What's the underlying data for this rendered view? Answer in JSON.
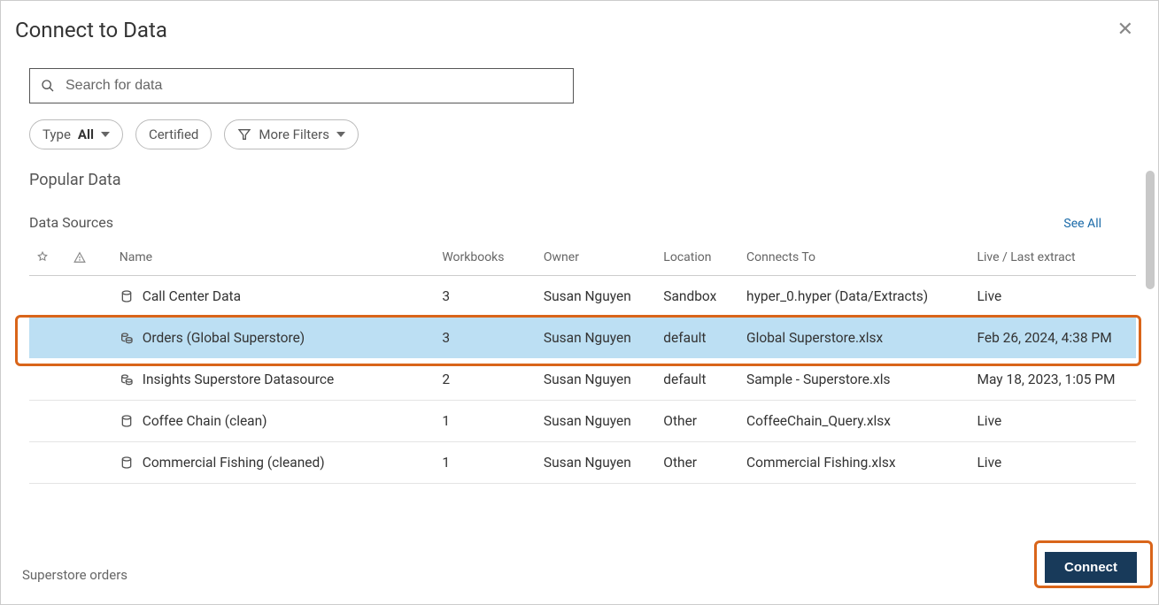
{
  "dialog": {
    "title": "Connect to Data"
  },
  "search": {
    "placeholder": "Search for data"
  },
  "filters": {
    "type_prefix": "Type",
    "type_value": "All",
    "certified": "Certified",
    "more": "More Filters"
  },
  "sections": {
    "popular": "Popular Data",
    "datasources": "Data Sources",
    "see_all": "See All"
  },
  "columns": {
    "name": "Name",
    "workbooks": "Workbooks",
    "owner": "Owner",
    "location": "Location",
    "connects_to": "Connects To",
    "live": "Live / Last extract"
  },
  "rows": [
    {
      "icon": "datasource",
      "name": "Call Center Data",
      "workbooks": "3",
      "owner": "Susan Nguyen",
      "location": "Sandbox",
      "connects_to": "hyper_0.hyper (Data/Extracts)",
      "live": "Live",
      "selected": false
    },
    {
      "icon": "published",
      "name": "Orders (Global Superstore)",
      "workbooks": "3",
      "owner": "Susan Nguyen",
      "location": "default",
      "connects_to": "Global Superstore.xlsx",
      "live": "Feb 26, 2024, 4:38 PM",
      "selected": true
    },
    {
      "icon": "published",
      "name": "Insights Superstore Datasource",
      "workbooks": "2",
      "owner": "Susan Nguyen",
      "location": "default",
      "connects_to": "Sample - Superstore.xls",
      "live": "May 18, 2023, 1:05 PM",
      "selected": false
    },
    {
      "icon": "datasource",
      "name": "Coffee Chain (clean)",
      "workbooks": "1",
      "owner": "Susan Nguyen",
      "location": "Other",
      "connects_to": "CoffeeChain_Query.xlsx",
      "live": "Live",
      "selected": false
    },
    {
      "icon": "datasource",
      "name": "Commercial Fishing (cleaned)",
      "workbooks": "1",
      "owner": "Susan Nguyen",
      "location": "Other",
      "connects_to": "Commercial Fishing.xlsx",
      "live": "Live",
      "selected": false
    }
  ],
  "footer": {
    "status": "Superstore orders",
    "connect": "Connect"
  }
}
